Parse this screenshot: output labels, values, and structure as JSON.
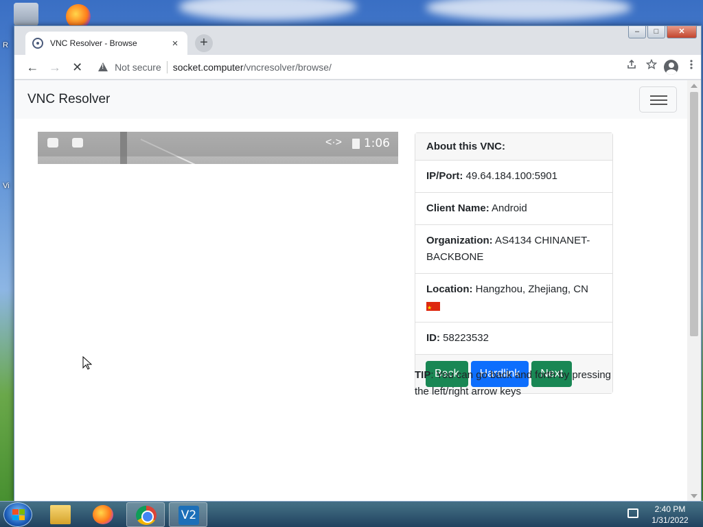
{
  "desktop": {
    "side_labels": [
      "R",
      "Vi"
    ]
  },
  "browser": {
    "tab_title": "VNC Resolver - Browse",
    "tab_close": "×",
    "new_tab": "+",
    "window_controls": {
      "minimize": "–",
      "maximize": "□",
      "close": "✕"
    },
    "nav": {
      "back": "←",
      "forward": "→",
      "reload": "✕"
    },
    "security_label": "Not secure",
    "url_host": "socket.computer",
    "url_path": "/vncresolver/browse/",
    "toolbar_icons": [
      "share-icon",
      "star-icon",
      "profile-icon",
      "menu-icon"
    ]
  },
  "page": {
    "brand": "VNC Resolver",
    "vnc_preview": {
      "time": "1:06",
      "arrows": "<·>"
    },
    "card": {
      "header": "About this VNC:",
      "ip_label": "IP/Port:",
      "ip_value": "49.64.184.100:5901",
      "client_label": "Client Name:",
      "client_value": "Android",
      "org_label": "Organization:",
      "org_value": "AS4134 CHINANET-BACKBONE",
      "location_label": "Location:",
      "location_value": "Hangzhou, Zhejiang, CN",
      "id_label": "ID:",
      "id_value": "58223532"
    },
    "buttons": {
      "back": "Back",
      "hardlink": "Hardlink",
      "next": "Next"
    },
    "tip_label": "TIP",
    "tip_text": ": You can go back and forth by pressing the left/right arrow keys",
    "colors": {
      "green": "#198754",
      "blue": "#0d6efd"
    }
  },
  "taskbar": {
    "apps": [
      "folder-icon",
      "firefox-icon",
      "chrome-icon",
      "vnc-viewer-icon"
    ],
    "vnc_glyph": "V2",
    "time": "2:40 PM",
    "date": "1/31/2022"
  }
}
